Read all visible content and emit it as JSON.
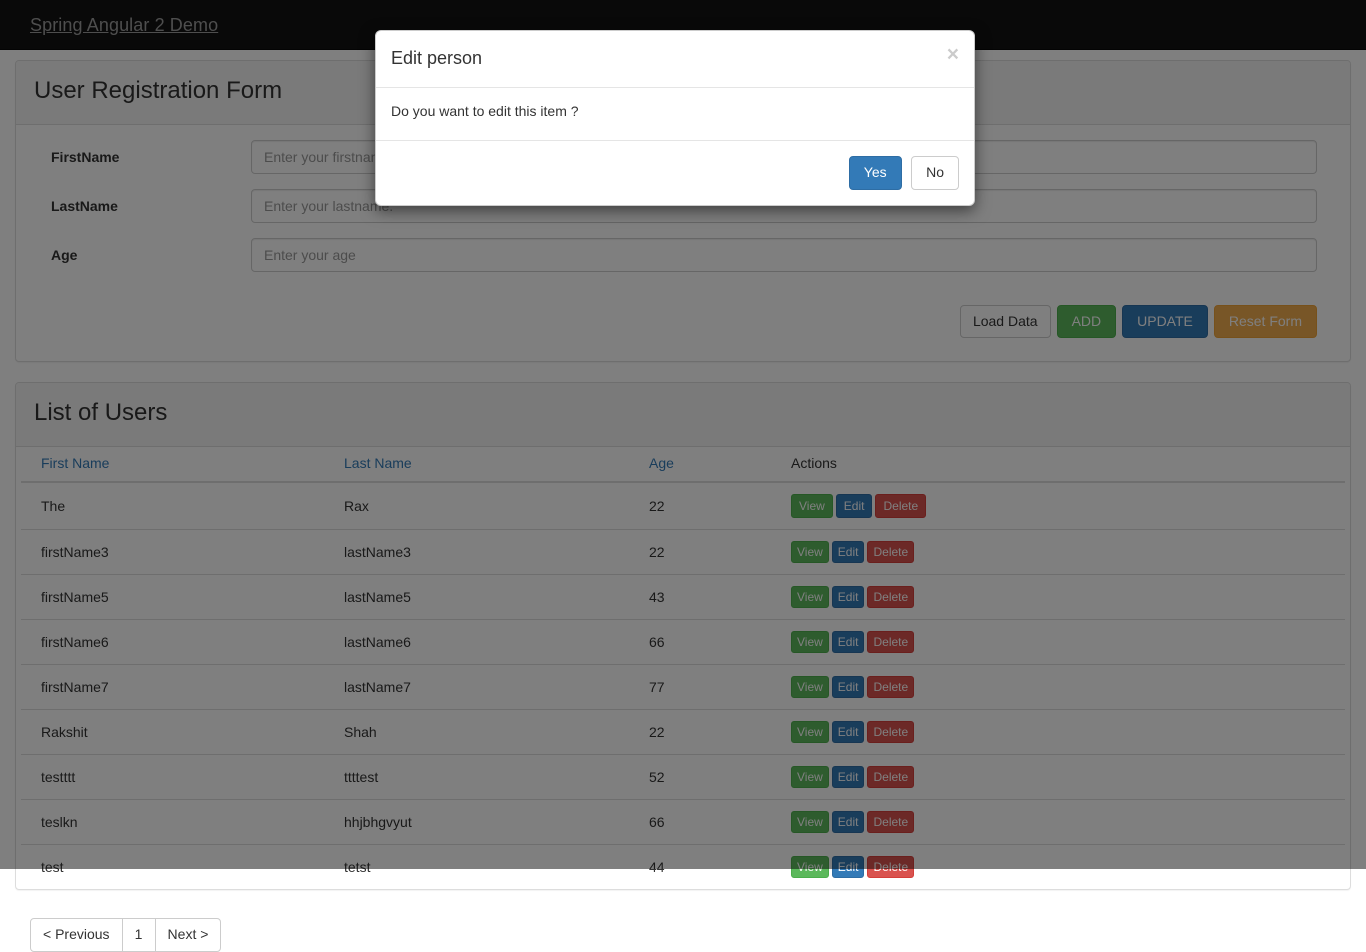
{
  "navbar": {
    "brand": "Spring Angular 2 Demo"
  },
  "form_panel": {
    "title": "User Registration Form",
    "fields": [
      {
        "label": "FirstName",
        "placeholder": "Enter your firstname",
        "value": ""
      },
      {
        "label": "LastName",
        "placeholder": "Enter your lastname. ",
        "value": ""
      },
      {
        "label": "Age",
        "placeholder": "Enter your age",
        "value": ""
      }
    ],
    "buttons": {
      "load_data": "Load Data",
      "add": "ADD",
      "update": "UPDATE",
      "reset": "Reset Form"
    }
  },
  "list_panel": {
    "title": "List of Users",
    "columns": [
      "First Name",
      "Last Name",
      "Age",
      "Actions"
    ],
    "row_actions": {
      "view": "View",
      "edit": "Edit",
      "delete": "Delete"
    },
    "rows": [
      {
        "first_name": "The",
        "last_name": "Rax",
        "age": "22"
      },
      {
        "first_name": "firstName3",
        "last_name": "lastName3",
        "age": "22"
      },
      {
        "first_name": "firstName5",
        "last_name": "lastName5",
        "age": "43"
      },
      {
        "first_name": "firstName6",
        "last_name": "lastName6",
        "age": "66"
      },
      {
        "first_name": "firstName7",
        "last_name": "lastName7",
        "age": "77"
      },
      {
        "first_name": "Rakshit",
        "last_name": "Shah",
        "age": "22"
      },
      {
        "first_name": "testttt",
        "last_name": "ttttest",
        "age": "52"
      },
      {
        "first_name": "teslkn",
        "last_name": "hhjbhgvyut",
        "age": "66"
      },
      {
        "first_name": "test",
        "last_name": "tetst",
        "age": "44"
      }
    ]
  },
  "pagination": {
    "previous": "< Previous",
    "current_page": "1",
    "next": "Next >"
  },
  "modal": {
    "title": "Edit person",
    "close_glyph": "×",
    "body_text": "Do you want to edit this item ?",
    "confirm_label": "Yes",
    "cancel_label": "No"
  },
  "colors": {
    "navbar_bg": "#121212",
    "brand_text": "#9d9d9d",
    "link_blue": "#337ab7",
    "success_green": "#5cb85c",
    "danger_red": "#d9534f",
    "warning_orange": "#f0ad4e",
    "panel_border": "#dddddd",
    "backdrop": "#000000"
  }
}
